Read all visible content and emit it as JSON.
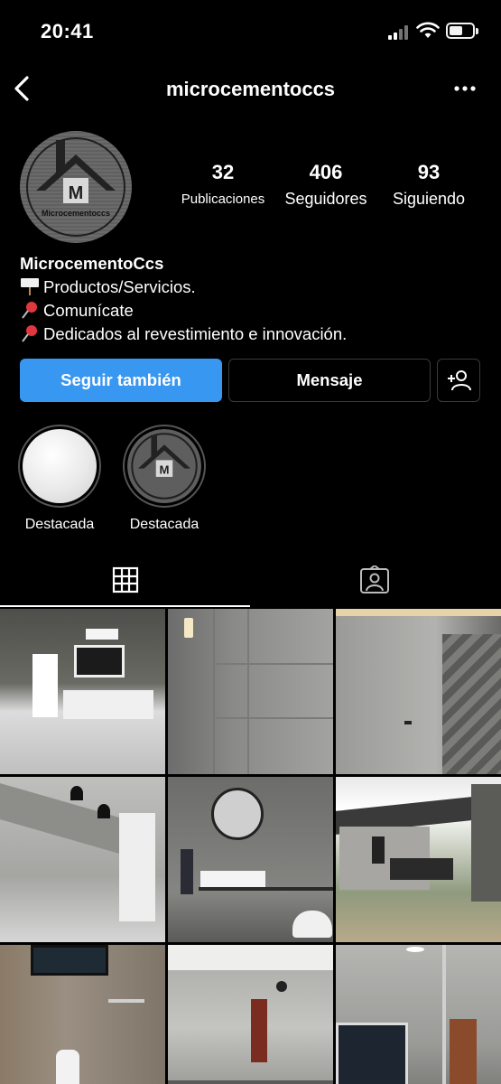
{
  "status_bar": {
    "time": "20:41"
  },
  "header": {
    "username": "microcementoccs"
  },
  "profile": {
    "avatar_text": "Microcementoccs",
    "stats": [
      {
        "value": "32",
        "label": "Publicaciones"
      },
      {
        "value": "406",
        "label": "Seguidores"
      },
      {
        "value": "93",
        "label": "Siguiendo"
      }
    ],
    "name": "MicrocementoCcs",
    "bio_lines": [
      "Productos/Servicios.",
      "Comunícate",
      "Dedicados al revestimiento e innovación."
    ]
  },
  "buttons": {
    "follow": "Seguir también",
    "message": "Mensaje"
  },
  "highlights": [
    {
      "label": "Destacada"
    },
    {
      "label": "Destacada"
    }
  ],
  "colors": {
    "accent": "#3897f0",
    "background": "#000000"
  },
  "icons": [
    "back-icon",
    "more-icon",
    "signal-icon",
    "wifi-icon",
    "battery-icon",
    "add-person-icon",
    "grid-icon",
    "tagged-icon"
  ]
}
